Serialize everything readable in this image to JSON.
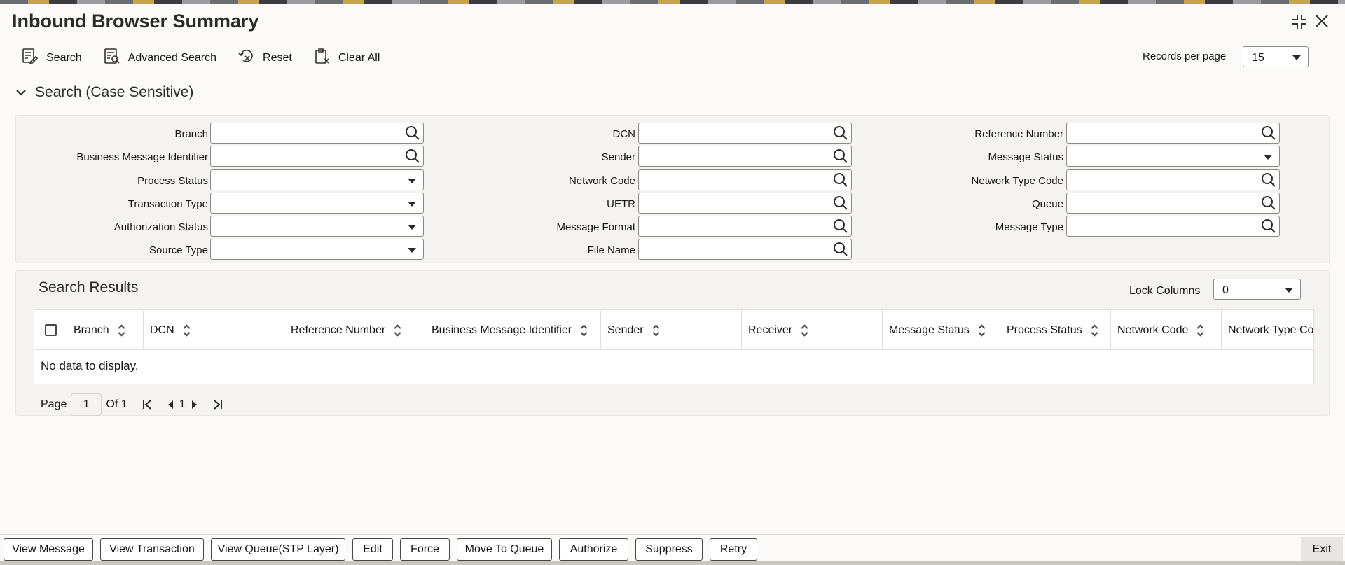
{
  "window": {
    "title": "Inbound Browser Summary"
  },
  "toolbar": {
    "search": "Search",
    "advanced_search": "Advanced Search",
    "reset": "Reset",
    "clear_all": "Clear All"
  },
  "records_per_page": {
    "label": "Records per page",
    "value": "15"
  },
  "search_section": {
    "title": "Search (Case Sensitive)",
    "fields": {
      "branch": "Branch",
      "business_message_identifier": "Business Message Identifier",
      "process_status": "Process Status",
      "transaction_type": "Transaction Type",
      "authorization_status": "Authorization Status",
      "source_type": "Source Type",
      "dcn": "DCN",
      "sender": "Sender",
      "network_code": "Network Code",
      "uetr": "UETR",
      "message_format": "Message Format",
      "file_name": "File Name",
      "reference_number": "Reference Number",
      "message_status": "Message Status",
      "network_type_code": "Network Type Code",
      "queue": "Queue",
      "message_type": "Message Type"
    }
  },
  "results": {
    "title": "Search Results",
    "lock_columns_label": "Lock Columns",
    "lock_columns_value": "0",
    "columns": [
      "Branch",
      "DCN",
      "Reference Number",
      "Business Message Identifier",
      "Sender",
      "Receiver",
      "Message Status",
      "Process Status",
      "Network Code",
      "Network Type Cod"
    ],
    "no_data": "No data to display.",
    "pager": {
      "page_label": "Page",
      "page_value": "1",
      "of_label": "Of 1",
      "current": "1"
    }
  },
  "footer": {
    "buttons": [
      "View Message",
      "View Transaction",
      "View Queue(STP Layer)",
      "Edit",
      "Force",
      "Move To Queue",
      "Authorize",
      "Suppress",
      "Retry"
    ],
    "exit": "Exit"
  },
  "colors": {
    "accent": "#2b2a28",
    "background": "#fbfaf9",
    "panel": "#f4f3f1"
  },
  "icons": [
    "search-icon",
    "advanced-search-icon",
    "reset-icon",
    "clear-all-icon",
    "collapse-icon",
    "close-icon",
    "chevron-down-icon",
    "magnifier-icon",
    "sort-icon",
    "first-page-icon",
    "prev-page-icon",
    "next-page-icon",
    "last-page-icon"
  ]
}
